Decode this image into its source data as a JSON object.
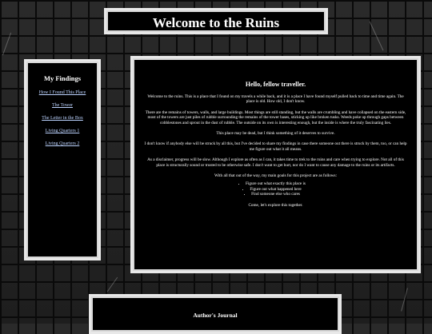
{
  "header": {
    "title": "Welcome to the Ruins"
  },
  "sidebar": {
    "heading": "My Findings",
    "links": [
      {
        "label": "How I Found This Place"
      },
      {
        "label": "The Tower"
      },
      {
        "label": "The Letter in the Box"
      },
      {
        "label": "Living Quarters 1"
      },
      {
        "label": "Living Quarters 2"
      }
    ]
  },
  "main": {
    "heading": "Hello, fellow traveller.",
    "paragraphs": [
      "Welcome to the ruins. This is a place that I found on my travels a while back, and it is a place I have found myself pulled back to time and time again. The place is old. How old, I don't know.",
      "There are the remains of towers, walls, and large buildings. Most things are still standing, but the walls are crumbling and have collapsed on the eastern side, most of the towers are just piles of rubble surrounding the remains of the tower bases, sticking up like broken tusks. Weeds poke up through gaps between cobblestones and sprout in the dust of rubble. The outside on its own is interesting enough, but the inside is where the truly fascinating lies.",
      "This place may be dead, but I think something of it deserves to survive.",
      "I don't know if anybody else will be struck by all this, but I've decided to share my findings in case there someone out there is struck by them, too, or can help me figure out what it all means.",
      "As a disclaimer, progress will be slow. Although I explore as often as I can, it takes time to trek to the ruins and care when trying to explore. Not all of this place is structurally sound or trusted to be otherwise safe. I don't want to get hurt, nor do I want to cause any damage to the ruins or its artifacts.",
      "With all that out of the way, my main goals for this project are as follows:"
    ],
    "goals": [
      "Figure out what exactly this place is",
      "Figure out what happened here",
      "Find someone else who cares"
    ],
    "closing": "Come, let's explore this together."
  },
  "journal": {
    "heading": "Author's Journal"
  },
  "colors": {
    "background": "#1a1a1a",
    "panel": "#000000",
    "border": "#e8e8e8",
    "link": "#bcd3ff"
  }
}
